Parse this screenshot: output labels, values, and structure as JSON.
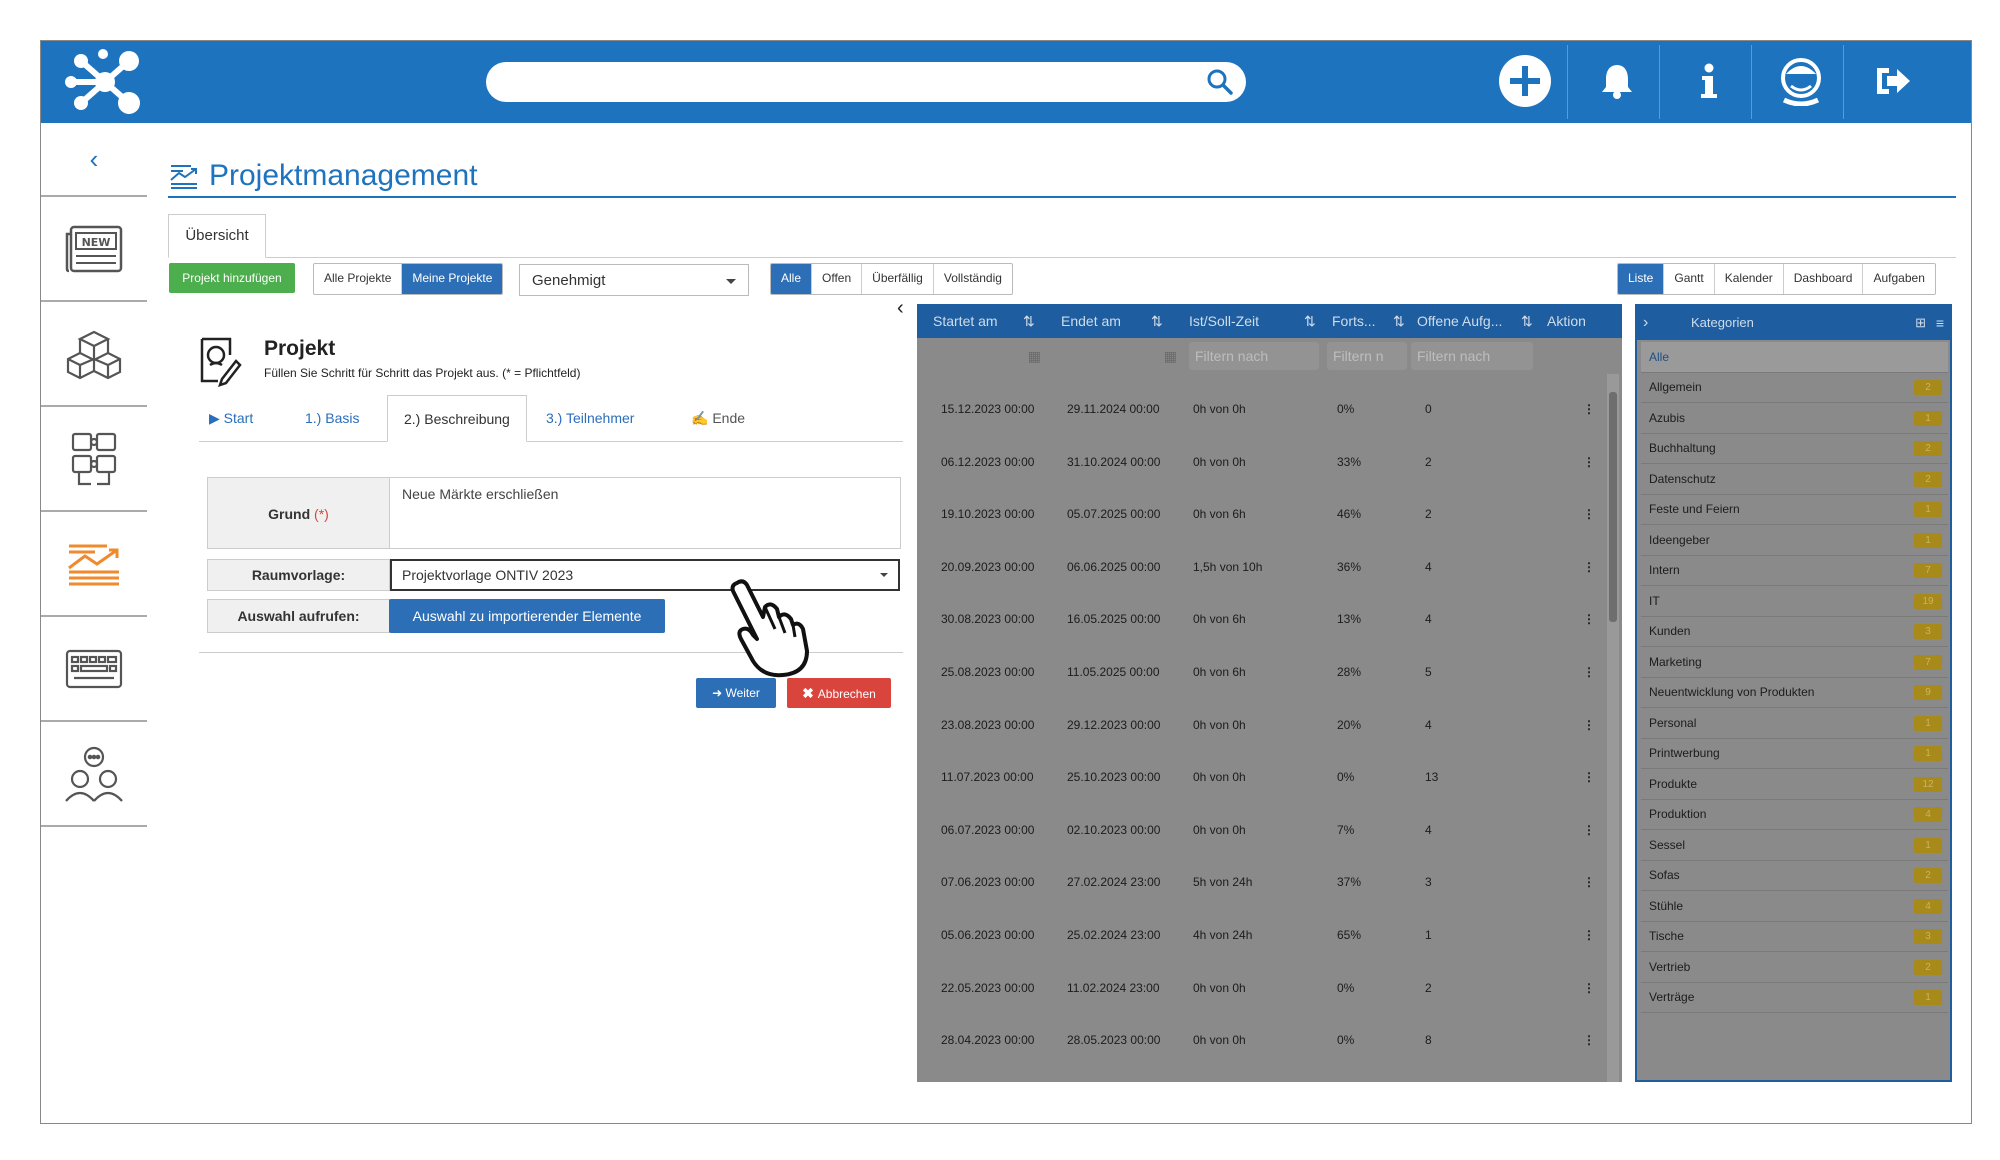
{
  "header": {
    "search_placeholder": "",
    "icons": [
      "logo-icon",
      "search-icon",
      "add-icon",
      "bell-icon",
      "info-icon",
      "user-avatar-icon",
      "logout-icon"
    ]
  },
  "page": {
    "title": "Projektmanagement"
  },
  "tabs": {
    "overview": "Übersicht"
  },
  "toolbar": {
    "add_project": "Projekt hinzufügen",
    "scope": [
      "Alle Projekte",
      "Meine Projekte"
    ],
    "scope_selected": "Meine Projekte",
    "status_select": "Genehmigt",
    "filters": [
      "Alle",
      "Offen",
      "Überfällig",
      "Vollständig"
    ],
    "filter_selected": "Alle",
    "views": [
      "Liste",
      "Gantt",
      "Kalender",
      "Dashboard",
      "Aufgaben"
    ],
    "view_selected": "Liste"
  },
  "form": {
    "title": "Projekt",
    "subtitle": "Füllen Sie Schritt für Schritt das Projekt aus. (* = Pflichtfeld)",
    "steps": [
      "Start",
      "1.) Basis",
      "2.) Beschreibung",
      "3.) Teilnehmer",
      "Ende"
    ],
    "active_step": "2.) Beschreibung",
    "grund_label": "Grund",
    "required_mark": "(*)",
    "grund_value": "Neue Märkte erschließen",
    "raumvorlage_label": "Raumvorlage:",
    "raumvorlage_value": "Projektvorlage ONTIV 2023",
    "auswahl_label": "Auswahl aufrufen:",
    "auswahl_button": "Auswahl zu importierender Elemente",
    "next": "Weiter",
    "cancel": "Abbrechen"
  },
  "grid": {
    "columns": [
      "Startet am",
      "Endet am",
      "Ist/Soll-Zeit",
      "Forts...",
      "Offene Aufg...",
      "Aktion"
    ],
    "filters": [
      "Filtern nach",
      "Filtern n",
      "Filtern nach"
    ],
    "rows": [
      {
        "start": "15.12.2023 00:00",
        "end": "29.11.2024 00:00",
        "time": "0h von 0h",
        "progress": "0%",
        "open": "0"
      },
      {
        "start": "06.12.2023 00:00",
        "end": "31.10.2024 00:00",
        "time": "0h von 0h",
        "progress": "33%",
        "open": "2"
      },
      {
        "start": "19.10.2023 00:00",
        "end": "05.07.2025 00:00",
        "time": "0h von 6h",
        "progress": "46%",
        "open": "2"
      },
      {
        "start": "20.09.2023 00:00",
        "end": "06.06.2025 00:00",
        "time": "1,5h von 10h",
        "progress": "36%",
        "open": "4"
      },
      {
        "start": "30.08.2023 00:00",
        "end": "16.05.2025 00:00",
        "time": "0h von 6h",
        "progress": "13%",
        "open": "4"
      },
      {
        "start": "25.08.2023 00:00",
        "end": "11.05.2025 00:00",
        "time": "0h von 6h",
        "progress": "28%",
        "open": "5"
      },
      {
        "start": "23.08.2023 00:00",
        "end": "29.12.2023 00:00",
        "time": "0h von 0h",
        "progress": "20%",
        "open": "4"
      },
      {
        "start": "11.07.2023 00:00",
        "end": "25.10.2023 00:00",
        "time": "0h von 0h",
        "progress": "0%",
        "open": "13"
      },
      {
        "start": "06.07.2023 00:00",
        "end": "02.10.2023 00:00",
        "time": "0h von 0h",
        "progress": "7%",
        "open": "4"
      },
      {
        "start": "07.06.2023 00:00",
        "end": "27.02.2024 23:00",
        "time": "5h von 24h",
        "progress": "37%",
        "open": "3"
      },
      {
        "start": "05.06.2023 00:00",
        "end": "25.02.2024 23:00",
        "time": "4h von 24h",
        "progress": "65%",
        "open": "1"
      },
      {
        "start": "22.05.2023 00:00",
        "end": "11.02.2024 23:00",
        "time": "0h von 0h",
        "progress": "0%",
        "open": "2"
      },
      {
        "start": "28.04.2023 00:00",
        "end": "28.05.2023 00:00",
        "time": "0h von 0h",
        "progress": "0%",
        "open": "8"
      }
    ]
  },
  "categories": {
    "title": "Kategorien",
    "all": "Alle",
    "items": [
      {
        "name": "Allgemein",
        "count": "2"
      },
      {
        "name": "Azubis",
        "count": "1"
      },
      {
        "name": "Buchhaltung",
        "count": "2"
      },
      {
        "name": "Datenschutz",
        "count": "2"
      },
      {
        "name": "Feste und Feiern",
        "count": "1"
      },
      {
        "name": "Ideengeber",
        "count": "1"
      },
      {
        "name": "Intern",
        "count": "7"
      },
      {
        "name": "IT",
        "count": "19"
      },
      {
        "name": "Kunden",
        "count": "3"
      },
      {
        "name": "Marketing",
        "count": "7"
      },
      {
        "name": "Neuentwicklung von Produkten",
        "count": "9"
      },
      {
        "name": "Personal",
        "count": "1"
      },
      {
        "name": "Printwerbung",
        "count": "1"
      },
      {
        "name": "Produkte",
        "count": "12"
      },
      {
        "name": "Produktion",
        "count": "4"
      },
      {
        "name": "Sessel",
        "count": "1"
      },
      {
        "name": "Sofas",
        "count": "2"
      },
      {
        "name": "Stühle",
        "count": "4"
      },
      {
        "name": "Tische",
        "count": "3"
      },
      {
        "name": "Vertrieb",
        "count": "2"
      },
      {
        "name": "Verträge",
        "count": "1"
      }
    ]
  },
  "colors": {
    "brand": "#1e73be",
    "green": "#4cae4c",
    "danger": "#d9453d",
    "badge": "#a88a1a"
  }
}
